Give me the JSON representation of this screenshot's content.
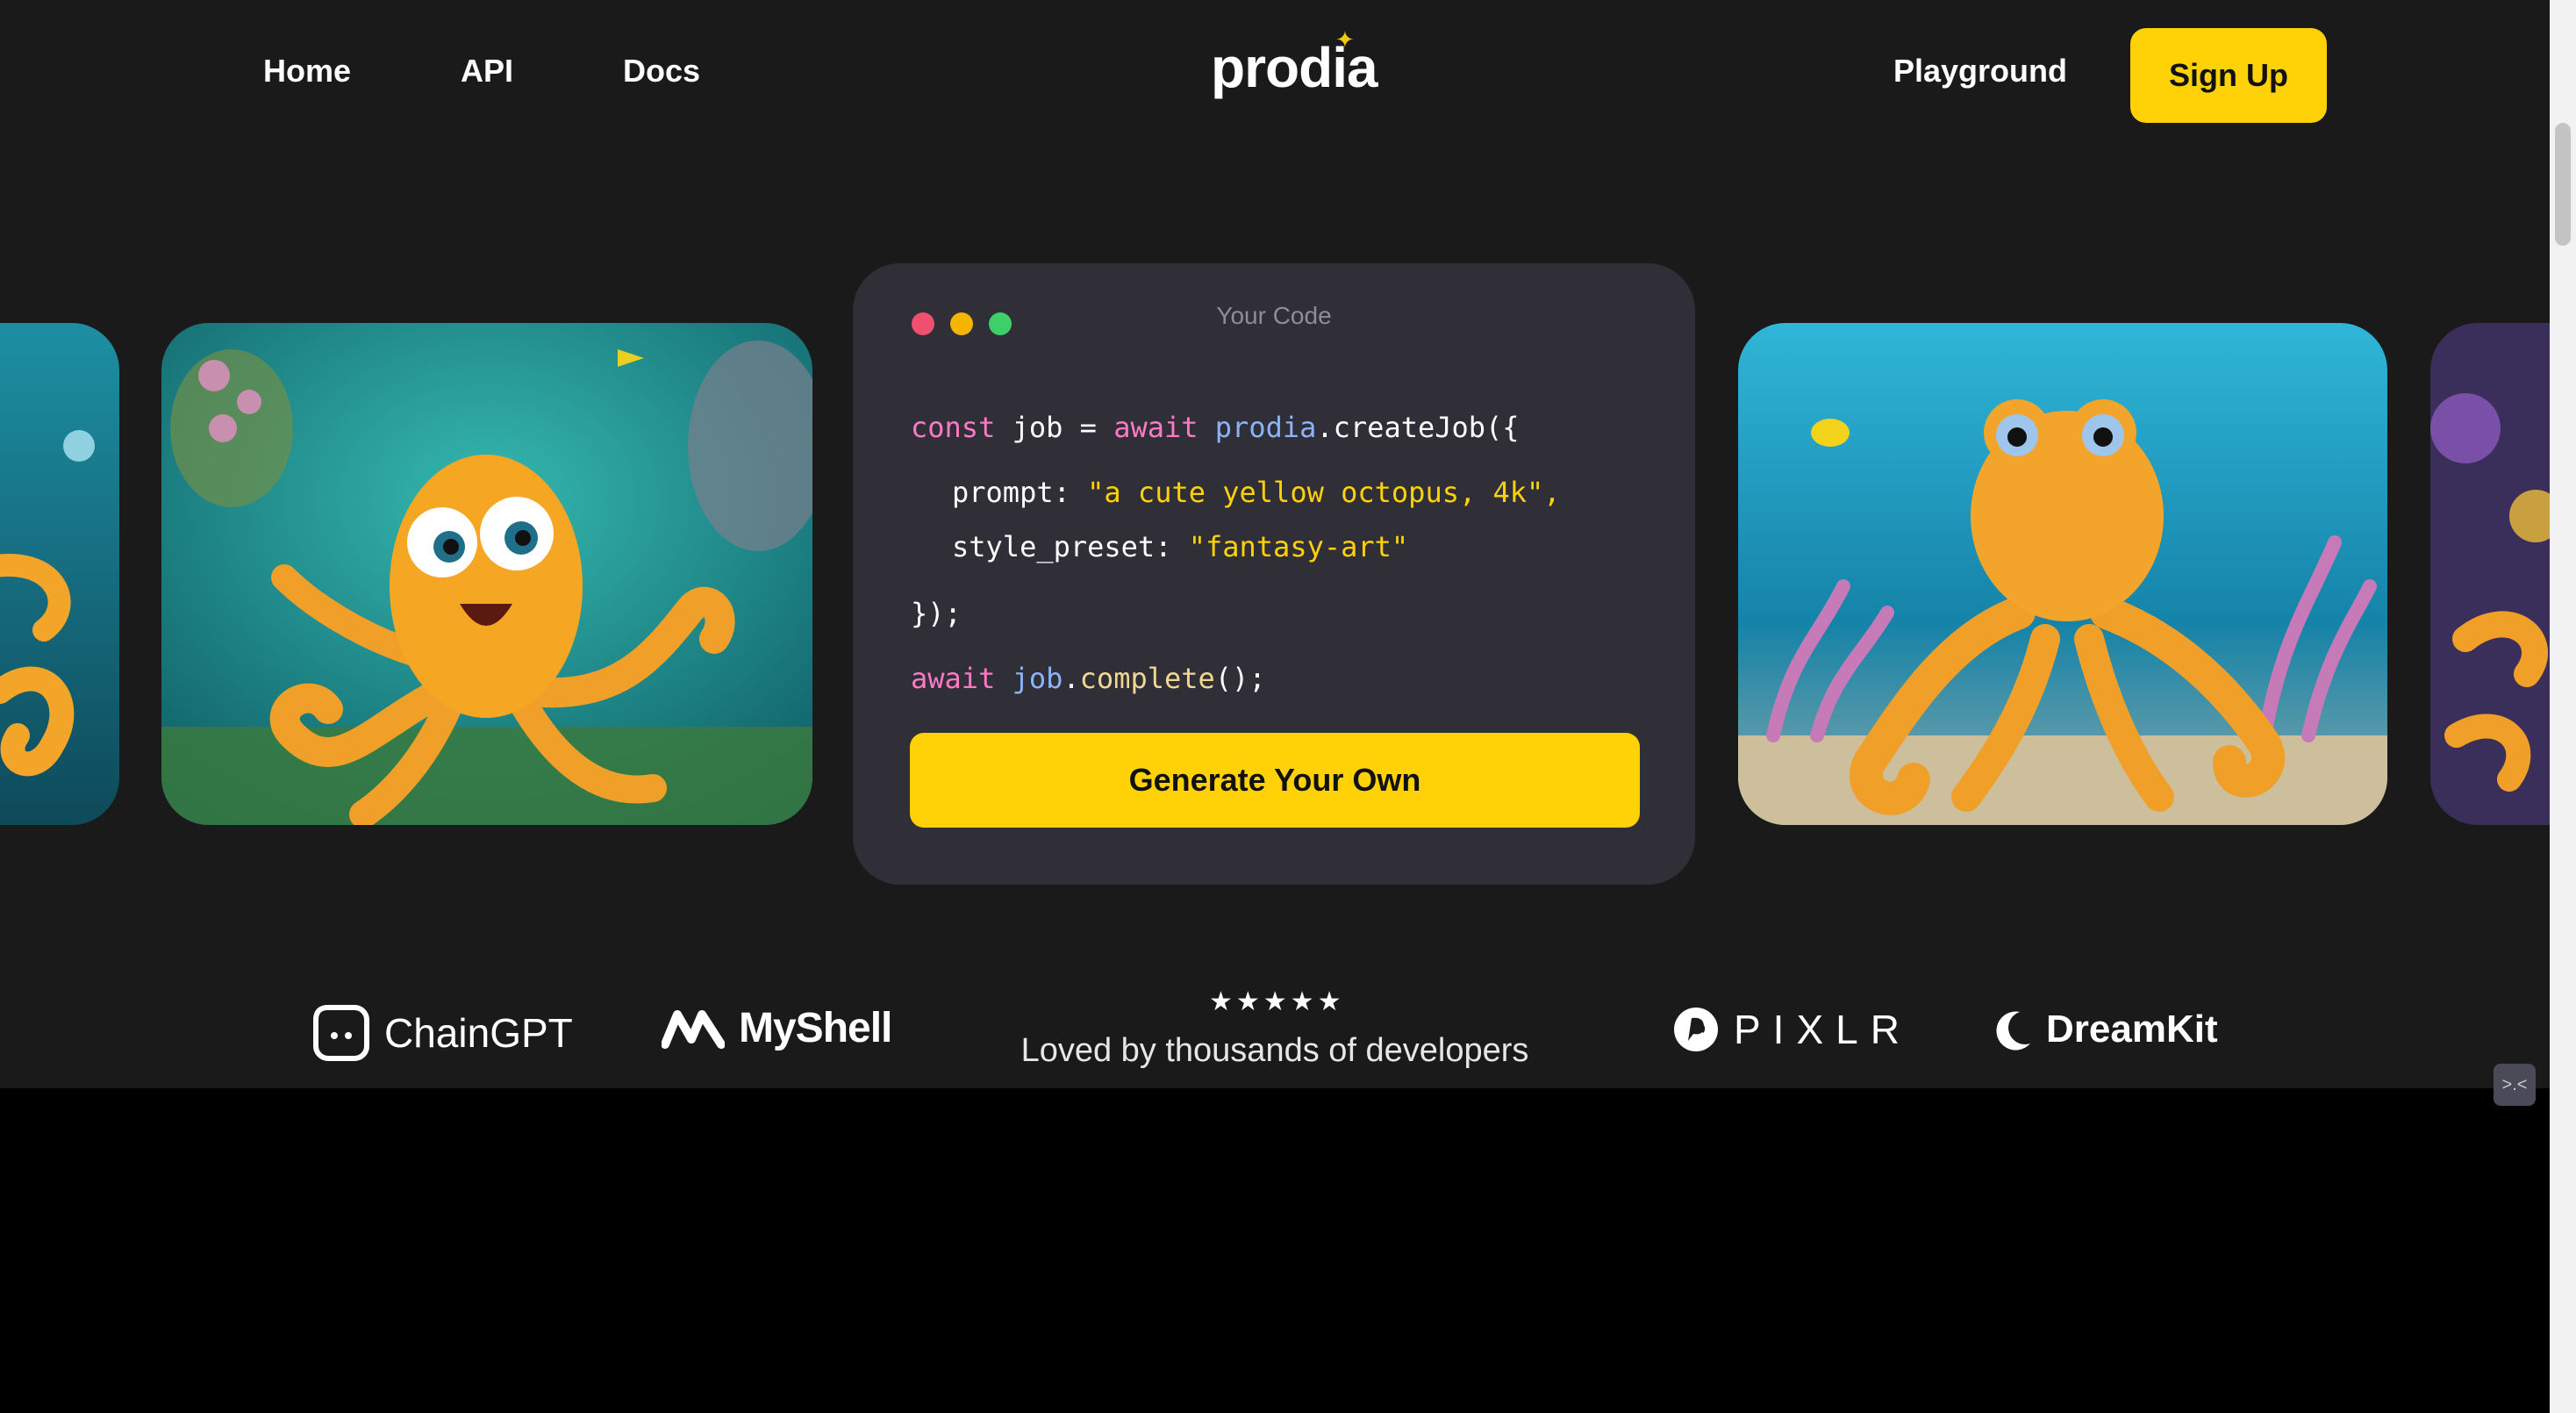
{
  "nav": {
    "home_label": "Home",
    "api_label": "API",
    "docs_label": "Docs",
    "logo_text": "prodia",
    "playground_label": "Playground",
    "signup_label": "Sign Up"
  },
  "code_panel": {
    "title": "Your Code",
    "line1": {
      "k1": "const",
      "v1": " job = ",
      "k2": "await",
      "sp": " ",
      "id": "prodia",
      "rest": ".createJob({"
    },
    "line2": {
      "key": "prompt: ",
      "str": "\"a cute yellow octopus, 4k\"",
      "end": ","
    },
    "line3": {
      "key": "style_preset: ",
      "str": "\"fantasy-art\""
    },
    "line4": "});",
    "line5": {
      "k1": "await",
      "sp": " ",
      "id": "job",
      "dot": ".",
      "fn": "complete",
      "end": "();"
    },
    "button_label": "Generate Your Own"
  },
  "partners": {
    "chaingpt": "ChainGPT",
    "myshell": "MyShell",
    "pixlr": "PIXLR",
    "dreamkit": "DreamKit"
  },
  "rating": {
    "stars": "★★★★★",
    "tagline": "Loved by thousands of developers"
  },
  "colors": {
    "accent": "#ffd208",
    "background": "#1a1a1a",
    "panel": "#302e37"
  },
  "icons": [
    "octopus-image",
    "chaingpt-logo-icon",
    "myshell-logo-icon",
    "pixlr-logo-icon",
    "dreamkit-moon-icon"
  ]
}
